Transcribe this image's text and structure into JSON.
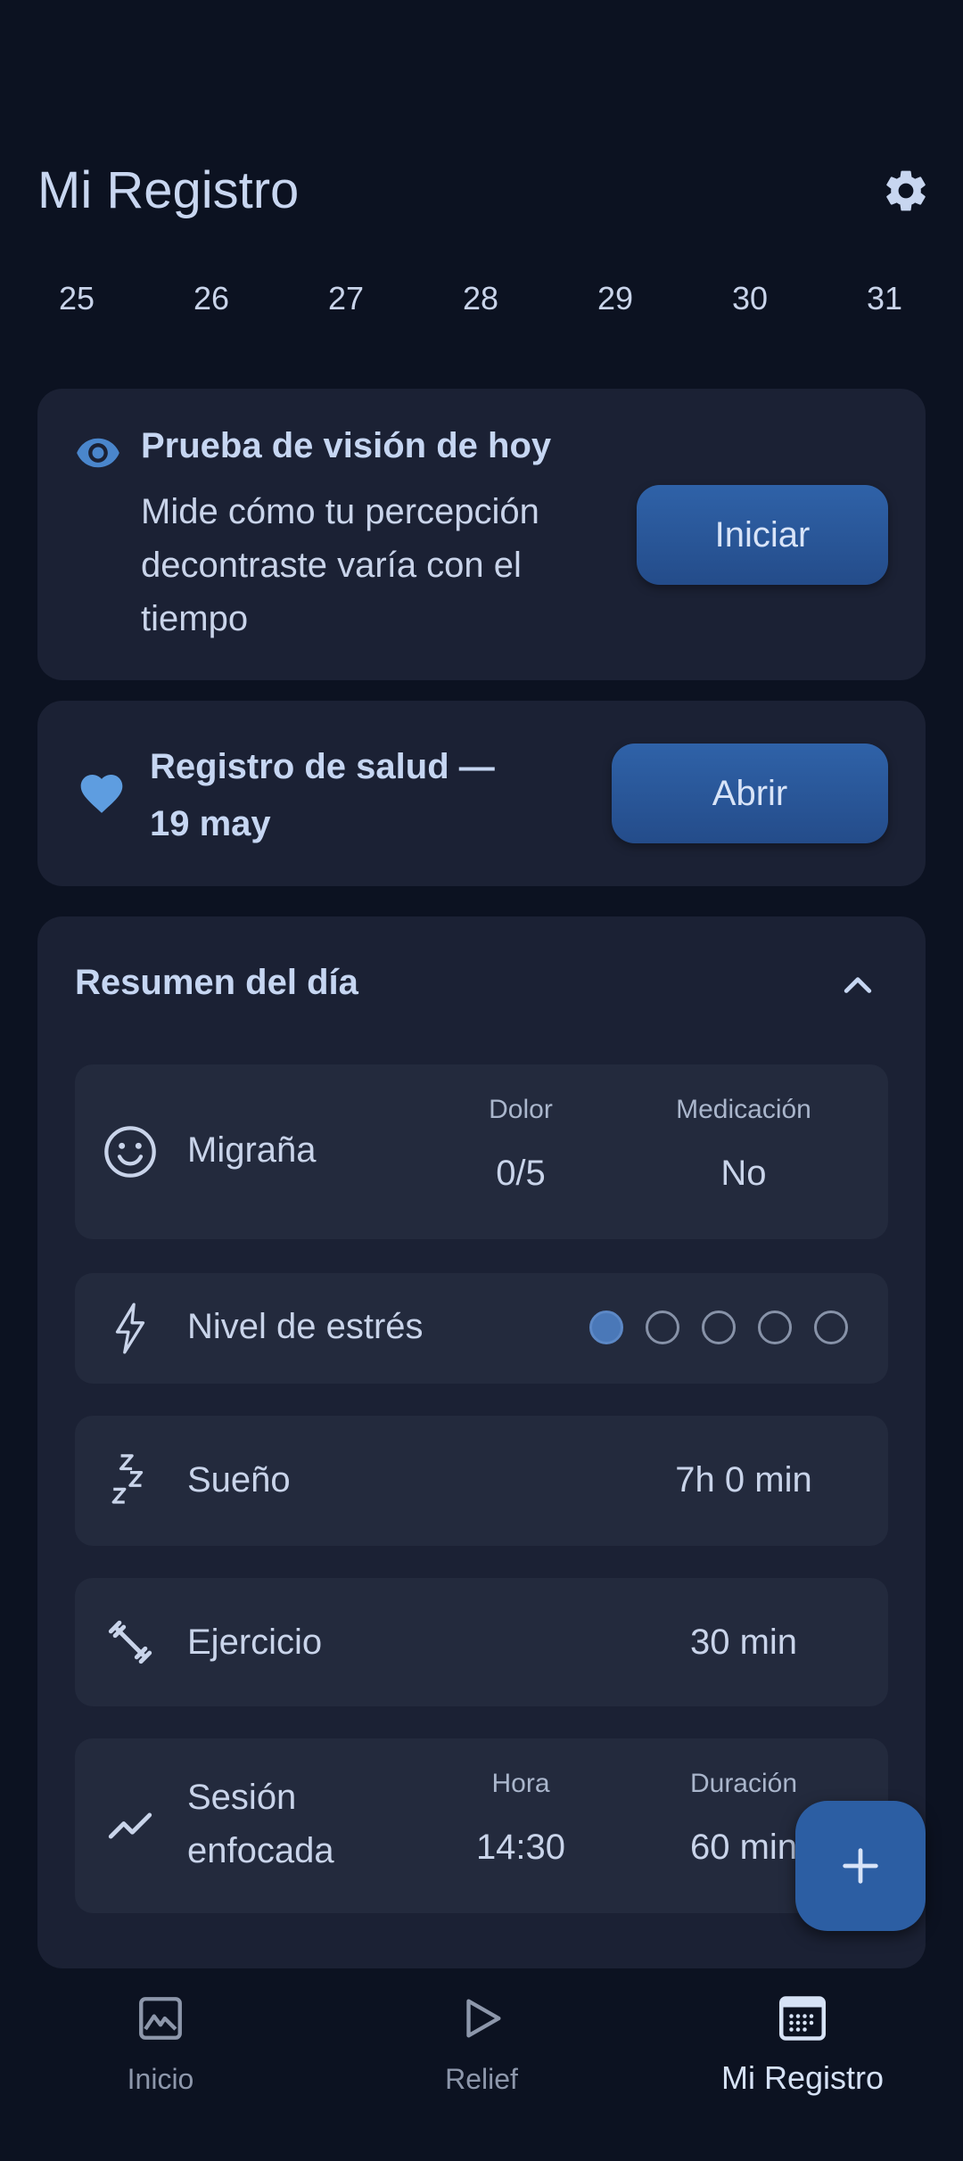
{
  "header": {
    "title": "Mi Registro"
  },
  "days": [
    "25",
    "26",
    "27",
    "28",
    "29",
    "30",
    "31"
  ],
  "vision_test": {
    "title": "Prueba de visión de hoy",
    "description": "Mide cómo tu percepción decontraste varía con el tiempo",
    "button": "Iniciar"
  },
  "health_log": {
    "title": "Registro de salud — 19 may",
    "button": "Abrir"
  },
  "summary": {
    "title": "Resumen del día",
    "migraine": {
      "label": "Migraña",
      "pain_caption": "Dolor",
      "pain_value": "0/5",
      "med_caption": "Medicación",
      "med_value": "No"
    },
    "stress": {
      "label": "Nivel de estrés",
      "level": 1,
      "max": 5
    },
    "sleep": {
      "label": "Sueño",
      "value": "7h 0 min"
    },
    "exercise": {
      "label": "Ejercicio",
      "value": "30 min"
    },
    "focus": {
      "label": "Sesión enfocada",
      "time_caption": "Hora",
      "time_value": "14:30",
      "duration_caption": "Duración",
      "duration_value": "60 min"
    }
  },
  "nav": {
    "items": [
      {
        "label": "Inicio",
        "icon": "image-icon"
      },
      {
        "label": "Relief",
        "icon": "play-icon"
      },
      {
        "label": "Mi Registro",
        "icon": "calendar-icon",
        "active": true
      }
    ]
  },
  "colors": {
    "accent": "#2c5ea3",
    "background": "#0c1221",
    "card": "#1b2134"
  }
}
